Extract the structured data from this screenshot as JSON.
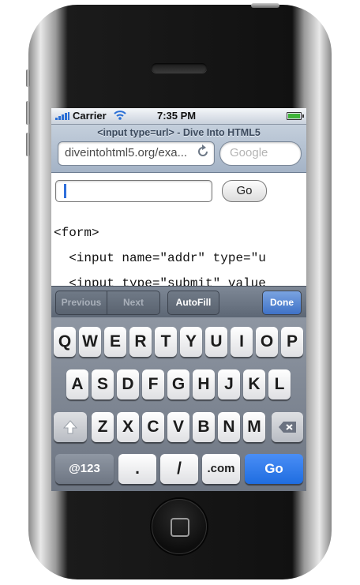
{
  "status_bar": {
    "carrier": "Carrier",
    "time": "7:35 PM"
  },
  "browser": {
    "page_title": "<input type=url> - Dive Into HTML5",
    "url": "diveintohtml5.org/exa...",
    "search_placeholder": "Google"
  },
  "page": {
    "input_value": "",
    "go_button": "Go",
    "code_lines": [
      "<form>",
      "  <input name=\"addr\" type=\"u",
      "  <input type=\"submit\" value"
    ]
  },
  "form_toolbar": {
    "previous": "Previous",
    "next": "Next",
    "autofill": "AutoFill",
    "done": "Done"
  },
  "keyboard": {
    "row1": [
      "Q",
      "W",
      "E",
      "R",
      "T",
      "Y",
      "U",
      "I",
      "O",
      "P"
    ],
    "row2": [
      "A",
      "S",
      "D",
      "F",
      "G",
      "H",
      "J",
      "K",
      "L"
    ],
    "row3": [
      "Z",
      "X",
      "C",
      "V",
      "B",
      "N",
      "M"
    ],
    "bottom": {
      "numbers": "@123",
      "dot": ".",
      "slash": "/",
      "dotcom": ".com",
      "go": "Go"
    }
  },
  "colors": {
    "accent_blue": "#1f6de0",
    "battery_green": "#3fb43a",
    "done_blue": "#3f72c7"
  },
  "icons": [
    "signal-bars-icon",
    "wifi-icon",
    "battery-icon",
    "reload-icon",
    "shift-icon",
    "backspace-icon",
    "home-button-icon"
  ]
}
